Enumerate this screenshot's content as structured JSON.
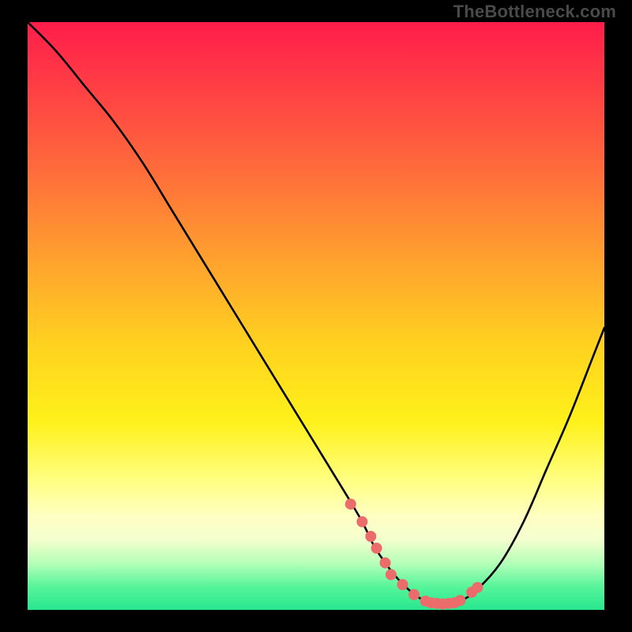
{
  "watermark": "TheBottleneck.com",
  "chart_data": {
    "type": "line",
    "title": "",
    "xlabel": "",
    "ylabel": "",
    "xlim": [
      0,
      100
    ],
    "ylim": [
      0,
      100
    ],
    "grid": false,
    "series": [
      {
        "name": "curve",
        "color": "#000000",
        "x": [
          0,
          5,
          10,
          15,
          20,
          25,
          30,
          35,
          40,
          45,
          50,
          55,
          58,
          60,
          62,
          64,
          66,
          68,
          70,
          72,
          74,
          76,
          78,
          82,
          86,
          90,
          94,
          98,
          100
        ],
        "values": [
          100,
          95,
          89,
          83,
          76,
          68,
          60,
          52,
          44,
          36,
          28,
          20,
          15,
          11,
          8,
          5.5,
          3.5,
          2,
          1.2,
          1,
          1.2,
          2,
          3.5,
          8,
          15,
          24,
          33,
          43,
          48
        ]
      }
    ],
    "markers": {
      "name": "dots",
      "color": "#ec6b6b",
      "radius_px": 7,
      "x": [
        56,
        58,
        59.5,
        60.5,
        62,
        63,
        65,
        67,
        69,
        70,
        71,
        72,
        73,
        74,
        75,
        77,
        78
      ],
      "values": [
        18,
        15,
        12.5,
        10.5,
        8,
        6,
        4.3,
        2.6,
        1.5,
        1.2,
        1.1,
        1.0,
        1.1,
        1.2,
        1.6,
        3.0,
        3.8
      ]
    },
    "background_gradient": {
      "direction": "top-to-bottom",
      "stops": [
        {
          "pos": 0.0,
          "color": "#ff1d4a"
        },
        {
          "pos": 0.25,
          "color": "#ff6b3b"
        },
        {
          "pos": 0.55,
          "color": "#ffd21f"
        },
        {
          "pos": 0.82,
          "color": "#ffffb0"
        },
        {
          "pos": 1.0,
          "color": "#27e78f"
        }
      ]
    }
  }
}
